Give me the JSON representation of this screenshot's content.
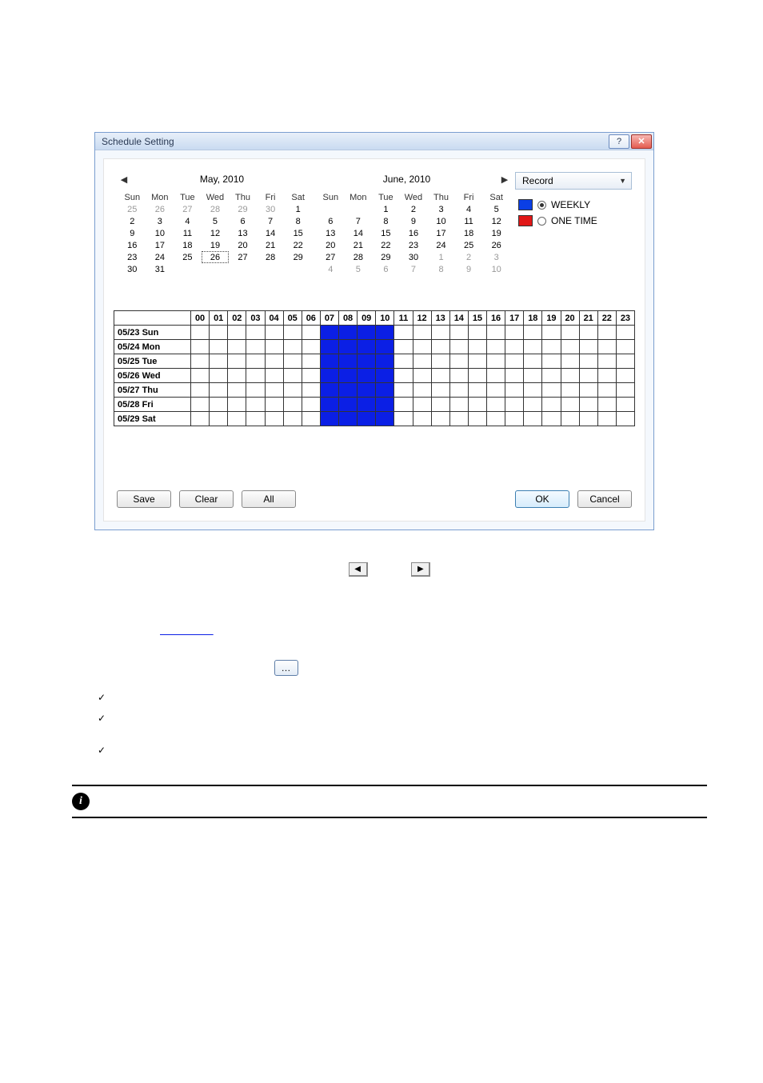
{
  "dialog": {
    "title": "Schedule Setting",
    "help_glyph": "?",
    "close_glyph": "✕"
  },
  "calendars": {
    "prev_arrow": "◀",
    "next_arrow": "▶",
    "dow": [
      "Sun",
      "Mon",
      "Tue",
      "Wed",
      "Thu",
      "Fri",
      "Sat"
    ],
    "left": {
      "title": "May, 2010",
      "rows": [
        [
          {
            "d": "25",
            "grey": true
          },
          {
            "d": "26",
            "grey": true
          },
          {
            "d": "27",
            "grey": true
          },
          {
            "d": "28",
            "grey": true
          },
          {
            "d": "29",
            "grey": true
          },
          {
            "d": "30",
            "grey": true
          },
          {
            "d": "1"
          }
        ],
        [
          {
            "d": "2"
          },
          {
            "d": "3"
          },
          {
            "d": "4"
          },
          {
            "d": "5"
          },
          {
            "d": "6"
          },
          {
            "d": "7"
          },
          {
            "d": "8"
          }
        ],
        [
          {
            "d": "9"
          },
          {
            "d": "10"
          },
          {
            "d": "11"
          },
          {
            "d": "12"
          },
          {
            "d": "13"
          },
          {
            "d": "14"
          },
          {
            "d": "15"
          }
        ],
        [
          {
            "d": "16"
          },
          {
            "d": "17"
          },
          {
            "d": "18"
          },
          {
            "d": "19"
          },
          {
            "d": "20"
          },
          {
            "d": "21"
          },
          {
            "d": "22"
          }
        ],
        [
          {
            "d": "23"
          },
          {
            "d": "24"
          },
          {
            "d": "25"
          },
          {
            "d": "26",
            "sel": true
          },
          {
            "d": "27"
          },
          {
            "d": "28"
          },
          {
            "d": "29"
          }
        ],
        [
          {
            "d": "30"
          },
          {
            "d": "31"
          },
          {
            "d": ""
          },
          {
            "d": ""
          },
          {
            "d": ""
          },
          {
            "d": ""
          },
          {
            "d": ""
          }
        ]
      ]
    },
    "right": {
      "title": "June, 2010",
      "rows": [
        [
          {
            "d": ""
          },
          {
            "d": ""
          },
          {
            "d": "1"
          },
          {
            "d": "2"
          },
          {
            "d": "3"
          },
          {
            "d": "4"
          },
          {
            "d": "5"
          }
        ],
        [
          {
            "d": "6"
          },
          {
            "d": "7"
          },
          {
            "d": "8"
          },
          {
            "d": "9"
          },
          {
            "d": "10"
          },
          {
            "d": "11"
          },
          {
            "d": "12"
          }
        ],
        [
          {
            "d": "13"
          },
          {
            "d": "14"
          },
          {
            "d": "15"
          },
          {
            "d": "16"
          },
          {
            "d": "17"
          },
          {
            "d": "18"
          },
          {
            "d": "19"
          }
        ],
        [
          {
            "d": "20"
          },
          {
            "d": "21"
          },
          {
            "d": "22"
          },
          {
            "d": "23"
          },
          {
            "d": "24"
          },
          {
            "d": "25"
          },
          {
            "d": "26"
          }
        ],
        [
          {
            "d": "27"
          },
          {
            "d": "28"
          },
          {
            "d": "29"
          },
          {
            "d": "30"
          },
          {
            "d": "1",
            "grey": true
          },
          {
            "d": "2",
            "grey": true
          },
          {
            "d": "3",
            "grey": true
          }
        ],
        [
          {
            "d": "4",
            "grey": true
          },
          {
            "d": "5",
            "grey": true
          },
          {
            "d": "6",
            "grey": true
          },
          {
            "d": "7",
            "grey": true
          },
          {
            "d": "8",
            "grey": true
          },
          {
            "d": "9",
            "grey": true
          },
          {
            "d": "10",
            "grey": true
          }
        ]
      ]
    }
  },
  "mode_dropdown": {
    "selected": "Record",
    "arrow": "▼"
  },
  "legend": {
    "weekly": "WEEKLY",
    "onetime": "ONE TIME"
  },
  "schedule": {
    "hours": [
      "00",
      "01",
      "02",
      "03",
      "04",
      "05",
      "06",
      "07",
      "08",
      "09",
      "10",
      "11",
      "12",
      "13",
      "14",
      "15",
      "16",
      "17",
      "18",
      "19",
      "20",
      "21",
      "22",
      "23"
    ],
    "rows": [
      {
        "label": "05/23 Sun",
        "fill_start": 7,
        "fill_end": 10
      },
      {
        "label": "05/24 Mon",
        "fill_start": 7,
        "fill_end": 10
      },
      {
        "label": "05/25 Tue",
        "fill_start": 7,
        "fill_end": 10
      },
      {
        "label": "05/26 Wed",
        "fill_start": 7,
        "fill_end": 10
      },
      {
        "label": "05/27 Thu",
        "fill_start": 7,
        "fill_end": 10
      },
      {
        "label": "05/28 Fri",
        "fill_start": 7,
        "fill_end": 10
      },
      {
        "label": "05/29 Sat",
        "fill_start": 7,
        "fill_end": 10
      }
    ]
  },
  "buttons": {
    "save": "Save",
    "clear": "Clear",
    "all": "All",
    "ok": "OK",
    "cancel": "Cancel"
  },
  "below": {
    "prev": "◀",
    "next": "▶",
    "ellipsis": "…",
    "info": "i",
    "check": "✓"
  }
}
